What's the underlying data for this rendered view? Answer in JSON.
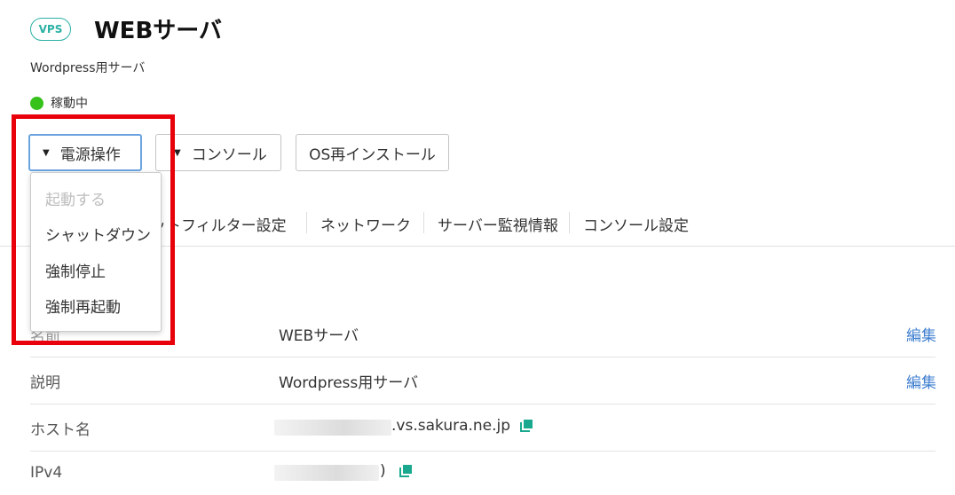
{
  "header": {
    "badge": "VPS",
    "title": "WEBサーバ",
    "subtitle": "Wordpress用サーバ",
    "status": "稼動中",
    "status_color": "#37c11b"
  },
  "buttons": {
    "power": "電源操作",
    "console": "コンソール",
    "reinstall": "OS再インストール"
  },
  "power_menu": {
    "items": [
      {
        "label": "起動する",
        "disabled": true
      },
      {
        "label": "シャットダウン",
        "disabled": false
      },
      {
        "label": "強制停止",
        "disabled": false
      },
      {
        "label": "強制再起動",
        "disabled": false
      }
    ]
  },
  "tabs": [
    {
      "label": "ットフィルター設定"
    },
    {
      "label": "ネットワーク"
    },
    {
      "label": "サーバー監視情報"
    },
    {
      "label": "コンソール設定"
    }
  ],
  "details": {
    "name_label_partial": "名前",
    "name_value": "WEBサーバ",
    "desc_label": "説明",
    "desc_value": "Wordpress用サーバ",
    "host_label": "ホスト名",
    "host_value_suffix": ".vs.sakura.ne.jp",
    "ipv4_label": "IPv4",
    "ipv4_value_suffix": ")",
    "edit_label": "編集"
  },
  "colors": {
    "accent": "#2bb0a4",
    "link": "#3f7fd0",
    "highlight": "#e8000b"
  }
}
